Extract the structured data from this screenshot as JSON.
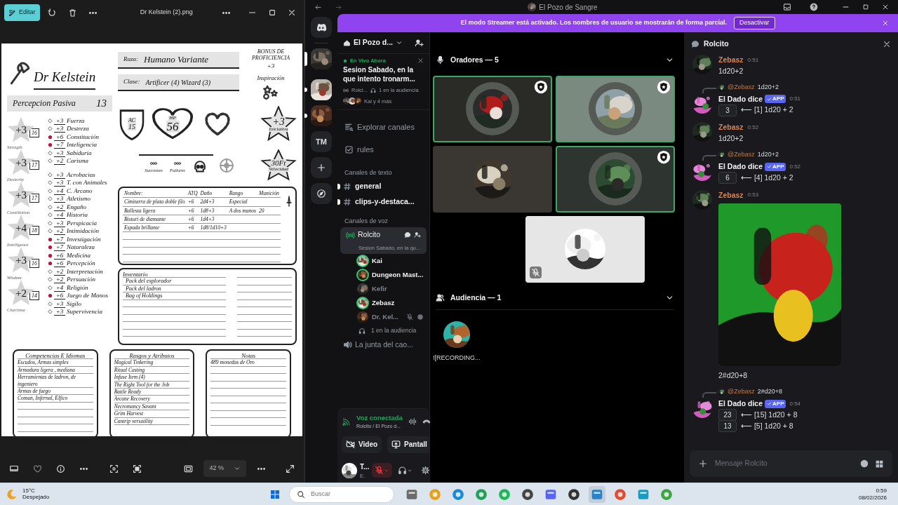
{
  "viewer": {
    "edit_button": "Editar",
    "title": "Dr Kelstein (2).png",
    "zoom": "42 %"
  },
  "sheet": {
    "name": "Dr Kelstein",
    "race_label": "Raza:",
    "race": "Humano Variante",
    "class_label": "Clase:",
    "class": "Artificer (4) Wizard (3)",
    "proficiency_label": "BONUS DE PROFICIENCIA",
    "proficiency": "+3",
    "inspiration_label": "Inspiración",
    "passive_label": "Percepcion Pasiva",
    "passive": "13",
    "ac_label": "AC",
    "ac": "15",
    "hp_label": "HP",
    "hp": "56",
    "initiative": "+3",
    "initiative_label": "Iniciativa",
    "speed": "30Ft",
    "speed_label": "Velocidad",
    "death_saves": [
      "Successes",
      "Failures"
    ],
    "abilities": [
      {
        "modifier": "+3",
        "score": "16",
        "label": "Strength"
      },
      {
        "modifier": "+3",
        "score": "17",
        "label": "Dexterity"
      },
      {
        "modifier": "+3",
        "score": "17",
        "label": "Constitution"
      },
      {
        "modifier": "+4",
        "score": "18",
        "label": "Intelligence"
      },
      {
        "modifier": "+3",
        "score": "16",
        "label": "Wisdom"
      },
      {
        "modifier": "+2",
        "score": "14",
        "label": "Charisma"
      }
    ],
    "saves": [
      {
        "value": "+3",
        "name": "Fuerza",
        "proficient": false
      },
      {
        "value": "+3",
        "name": "Destreza",
        "proficient": false
      },
      {
        "value": "+6",
        "name": "Constitución",
        "proficient": true
      },
      {
        "value": "+7",
        "name": "Inteligencia",
        "proficient": true
      },
      {
        "value": "+3",
        "name": "Sabiduria",
        "proficient": false
      },
      {
        "value": "+2",
        "name": "Carisma",
        "proficient": false
      }
    ],
    "skills": [
      {
        "value": "+3",
        "name": "Acrobacias",
        "proficient": false
      },
      {
        "value": "+3",
        "name": "T. con Animales",
        "proficient": false
      },
      {
        "value": "+4",
        "name": "C. Arcano",
        "proficient": false
      },
      {
        "value": "+3",
        "name": "Atletismo",
        "proficient": false
      },
      {
        "value": "+2",
        "name": "Engaño",
        "proficient": false
      },
      {
        "value": "+4",
        "name": "Historia",
        "proficient": false
      },
      {
        "value": "+3",
        "name": "Perspicacia",
        "proficient": false
      },
      {
        "value": "+2",
        "name": "Intimidación",
        "proficient": false
      },
      {
        "value": "+7",
        "name": "Investigación",
        "proficient": true
      },
      {
        "value": "+7",
        "name": "Naturaleza",
        "proficient": true
      },
      {
        "value": "+6",
        "name": "Medicina",
        "proficient": true
      },
      {
        "value": "+6",
        "name": "Percepción",
        "proficient": true
      },
      {
        "value": "+2",
        "name": "Interpretación",
        "proficient": false
      },
      {
        "value": "+2",
        "name": "Persuación",
        "proficient": false
      },
      {
        "value": "+4",
        "name": "Religión",
        "proficient": false
      },
      {
        "value": "+6",
        "name": "Juego de Manos",
        "proficient": true
      },
      {
        "value": "+3",
        "name": "Sigilo",
        "proficient": false
      },
      {
        "value": "+3",
        "name": "Supervivencia",
        "proficient": false
      }
    ],
    "attacks": {
      "columns": [
        "Nombre:",
        "ATQ",
        "Daño",
        "Rango",
        "Munición"
      ],
      "rows": [
        {
          "name": "Cimitarra de plata doble filo",
          "attack": "+6",
          "damage": "2d4+3",
          "range": "Especial"
        },
        {
          "name": "Ballesta ligera",
          "attack": "+6",
          "damage": "1d8+3",
          "range": "A dos manos",
          "ammo": "20"
        },
        {
          "name": "Bisturi de diamante",
          "attack": "+6",
          "damage": "1d4+3"
        },
        {
          "name": "Espada brillante",
          "attack": "+6",
          "damage": "1d8/1d10+3"
        }
      ]
    },
    "inventory": {
      "title": "Inventario",
      "items": [
        "Pack del explorador",
        "Pack del ladron",
        "Bag of Holdings"
      ]
    },
    "proficiencies": {
      "title": "Competencias E Idiomas",
      "items": [
        "Escudos, Armas simples",
        "Armadura ligera , mediana",
        "Herramientas de ladron, de ingeniero",
        "Armas de fuego",
        "Comun, Infernal, Elfico"
      ]
    },
    "features": {
      "title": "Rasgos y Atributos",
      "items": [
        "Magical Tinkering",
        "Ritual Casting",
        "Infuse Item (4)",
        "The Right Tool for the Job",
        "Battle Ready",
        "Arcane Recovery",
        "Necromancy Savant",
        "Grim Harvest",
        "Cantrip versatility"
      ]
    },
    "notes": {
      "title": "Notas",
      "items": [
        "489 monedas de Oro"
      ]
    }
  },
  "discord": {
    "title": "El Pozo de Sangre",
    "banner": {
      "text": "El modo Streamer está activado. Los nombres de usuario se mostrarán de forma parcial.",
      "button": "Desactivar"
    },
    "servers": [
      {
        "kind": "picture",
        "selected": true,
        "unread": false
      },
      {
        "kind": "picture",
        "selected": false,
        "unread": true
      },
      {
        "kind": "picture",
        "selected": false,
        "unread": true
      },
      {
        "kind": "text",
        "label": "TM",
        "selected": false,
        "unread": false
      }
    ],
    "server_name": "El Pozo d...",
    "live": {
      "badge": "En Vivo Ahora",
      "title": "Sesion Sabado, en la que intento tronarm...",
      "host": "Rolci...",
      "audience": "1 en la audiencia",
      "members": "Kai y 4 más"
    },
    "nav": [
      {
        "kind": "browse",
        "label": "Explorar canales"
      },
      {
        "kind": "rules",
        "label": "rules"
      }
    ],
    "text_category": "Canales de texto",
    "text_channels": [
      {
        "name": "general",
        "unread": true
      },
      {
        "name": "clips-y-destaca...",
        "unread": true
      }
    ],
    "voice_category": "Canales de voz",
    "voice_channels": [
      {
        "name": "Rolcito",
        "selected": true,
        "topic": "Sesion Sabado, en la qu...",
        "members": [
          {
            "name": "Kai",
            "speaking": true,
            "muted": false
          },
          {
            "name": "Dungeon Mast...",
            "speaking": true,
            "muted": false
          },
          {
            "name": "Kefir",
            "speaking": false,
            "muted": false
          },
          {
            "name": "Zebasz",
            "speaking": true,
            "muted": false
          },
          {
            "name": "Dr. Kel...",
            "speaking": false,
            "muted": true
          }
        ],
        "audience": "1 en la audiencia"
      },
      {
        "name": "La junta del cao...",
        "selected": false
      }
    ],
    "voice_panel": {
      "status": "Voz conectada",
      "location": "Rolcito / El Pozo d...",
      "buttons": [
        "Video",
        "Pantall"
      ]
    },
    "user_panel": {
      "name": "T...",
      "status": "E.",
      "muted": true
    },
    "stage": {
      "speakers_heading": "Oradores — 5",
      "speakers": [
        {
          "speaking": true,
          "moderator": true,
          "muted": false
        },
        {
          "speaking": true,
          "moderator": true,
          "muted": false
        },
        {
          "speaking": false,
          "moderator": false,
          "muted": false
        },
        {
          "speaking": true,
          "moderator": true,
          "muted": false
        },
        {
          "speaking": false,
          "moderator": false,
          "muted": true
        }
      ],
      "audience_heading": "Audiencia — 1",
      "audience": [
        {
          "name": "![RECORDING..."
        }
      ]
    },
    "chat": {
      "title": "Rolcito",
      "placeholder": "Mensaje Rolcito",
      "messages": [
        {
          "kind": "user",
          "author": "Zebasz",
          "color": "#e0824c",
          "time": "0:51",
          "text": "1d20+2"
        },
        {
          "kind": "bot",
          "reply": {
            "mention": "@Zebasz",
            "text": "1d20+2"
          },
          "author": "El Dado dice",
          "tag": "APP",
          "time": "0:51",
          "rolls": [
            {
              "total": "3",
              "detail": "⟵ [1] 1d20 + 2"
            }
          ]
        },
        {
          "kind": "user",
          "author": "Zebasz",
          "color": "#e0824c",
          "time": "0:52",
          "text": "1d20+2"
        },
        {
          "kind": "bot",
          "reply": {
            "mention": "@Zebasz",
            "text": "1d20+2"
          },
          "author": "El Dado dice",
          "tag": "APP",
          "time": "0:52",
          "rolls": [
            {
              "total": "6",
              "detail": "⟵ [4] 1d20 + 2"
            }
          ]
        },
        {
          "kind": "user",
          "author": "Zebasz",
          "color": "#e0824c",
          "time": "0:53",
          "attachment": {
            "kind": "picture"
          },
          "text": "2#d20+8"
        },
        {
          "kind": "bot",
          "reply": {
            "mention": "@Zebasz",
            "text": "2#d20+8"
          },
          "author": "El Dado dice",
          "tag": "APP",
          "time": "0:54",
          "rolls": [
            {
              "total": "23",
              "detail": "⟵ [15] 1d20 + 8"
            },
            {
              "total": "13",
              "detail": "⟵ [5] 1d20 + 8"
            }
          ]
        }
      ]
    }
  },
  "taskbar": {
    "temperature": "15°C",
    "condition": "Despejado",
    "search_placeholder": "Buscar",
    "time": "0:59",
    "date": "08/02/2026"
  }
}
